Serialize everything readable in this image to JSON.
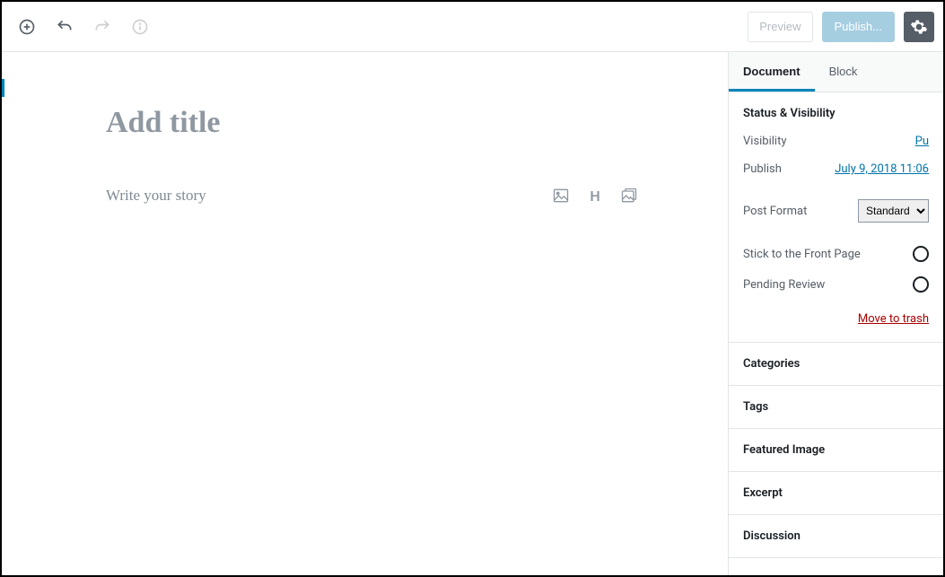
{
  "toolbar": {
    "preview_label": "Preview",
    "publish_label": "Publish..."
  },
  "editor": {
    "title_placeholder": "Add title",
    "story_placeholder": "Write your story"
  },
  "sidebar": {
    "tabs": {
      "document": "Document",
      "block": "Block"
    },
    "status": {
      "heading": "Status & Visibility",
      "visibility_label": "Visibility",
      "visibility_value": "Pu",
      "publish_label": "Publish",
      "publish_value": "July 9, 2018 11:06",
      "post_format_label": "Post Format",
      "post_format_value": "Standard",
      "stick_label": "Stick to the Front Page",
      "pending_label": "Pending Review",
      "trash_label": "Move to trash"
    },
    "panels": {
      "categories": "Categories",
      "tags": "Tags",
      "featured_image": "Featured Image",
      "excerpt": "Excerpt",
      "discussion": "Discussion"
    }
  }
}
